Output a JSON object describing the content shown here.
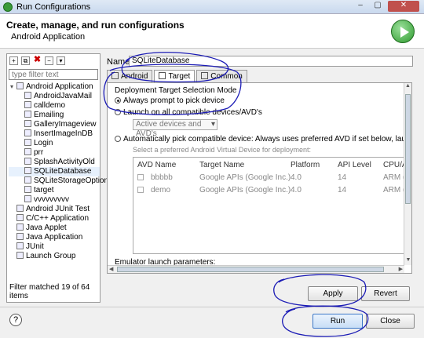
{
  "window": {
    "title": "Run Configurations",
    "buttons": [
      "–",
      "▢",
      "✕"
    ]
  },
  "header": {
    "title": "Create, manage, and run configurations",
    "subtitle": "Android Application"
  },
  "left": {
    "filter_placeholder": "type filter text",
    "tree": [
      {
        "label": "Android Application",
        "level": 0,
        "expanded": true
      },
      {
        "label": "AndroidJavaMail",
        "level": 1
      },
      {
        "label": "calldemo",
        "level": 1
      },
      {
        "label": "Emailing",
        "level": 1
      },
      {
        "label": "GalleryImageview",
        "level": 1
      },
      {
        "label": "InsertImageInDB",
        "level": 1
      },
      {
        "label": "Login",
        "level": 1
      },
      {
        "label": "prr",
        "level": 1
      },
      {
        "label": "SplashActivityOld",
        "level": 1
      },
      {
        "label": "SQLiteDatabase",
        "level": 1,
        "selected": true
      },
      {
        "label": "SQLiteStorageOption",
        "level": 1
      },
      {
        "label": "target",
        "level": 1
      },
      {
        "label": "vvvvvvvvv",
        "level": 1
      },
      {
        "label": "Android JUnit Test",
        "level": 0
      },
      {
        "label": "C/C++ Application",
        "level": 0
      },
      {
        "label": "Java Applet",
        "level": 0
      },
      {
        "label": "Java Application",
        "level": 0
      },
      {
        "label": "JUnit",
        "level": 0
      },
      {
        "label": "Launch Group",
        "level": 0
      }
    ],
    "status": "Filter matched 19 of 64 items"
  },
  "config": {
    "name_label": "Name:",
    "name_value": "SQLiteDatabase",
    "tabs": [
      "Android",
      "Target",
      "Common"
    ],
    "active_tab": "Target",
    "group_label": "Deployment Target Selection Mode",
    "radio_prompt": "Always prompt to pick device",
    "radio_all": "Launch on all compatible devices/AVD's",
    "combo_value": "Active devices and AVD's",
    "radio_auto": "Automatically pick compatible device: Always uses preferred AVD if set below, launches on compatil",
    "avd_hint": "Select a preferred Android Virtual Device for deployment:",
    "table_headers": [
      "AVD Name",
      "Target Name",
      "Platform",
      "API Level",
      "CPU/AB"
    ],
    "rows": [
      {
        "name": "bbbbb",
        "target": "Google APIs (Google Inc.)",
        "platform": "4.0",
        "api": "14",
        "cpu": "ARM (a"
      },
      {
        "name": "demo",
        "target": "Google APIs (Google Inc.)",
        "platform": "4.0",
        "api": "14",
        "cpu": "ARM (a"
      }
    ],
    "emulator_label": "Emulator launch parameters:"
  },
  "buttons": {
    "apply": "Apply",
    "revert": "Revert",
    "run": "Run",
    "close": "Close",
    "help": "?"
  },
  "colors": {
    "annotation": "#1b1bb5",
    "selection": "#e7f1fd",
    "run_green": "#2e9a2e"
  }
}
